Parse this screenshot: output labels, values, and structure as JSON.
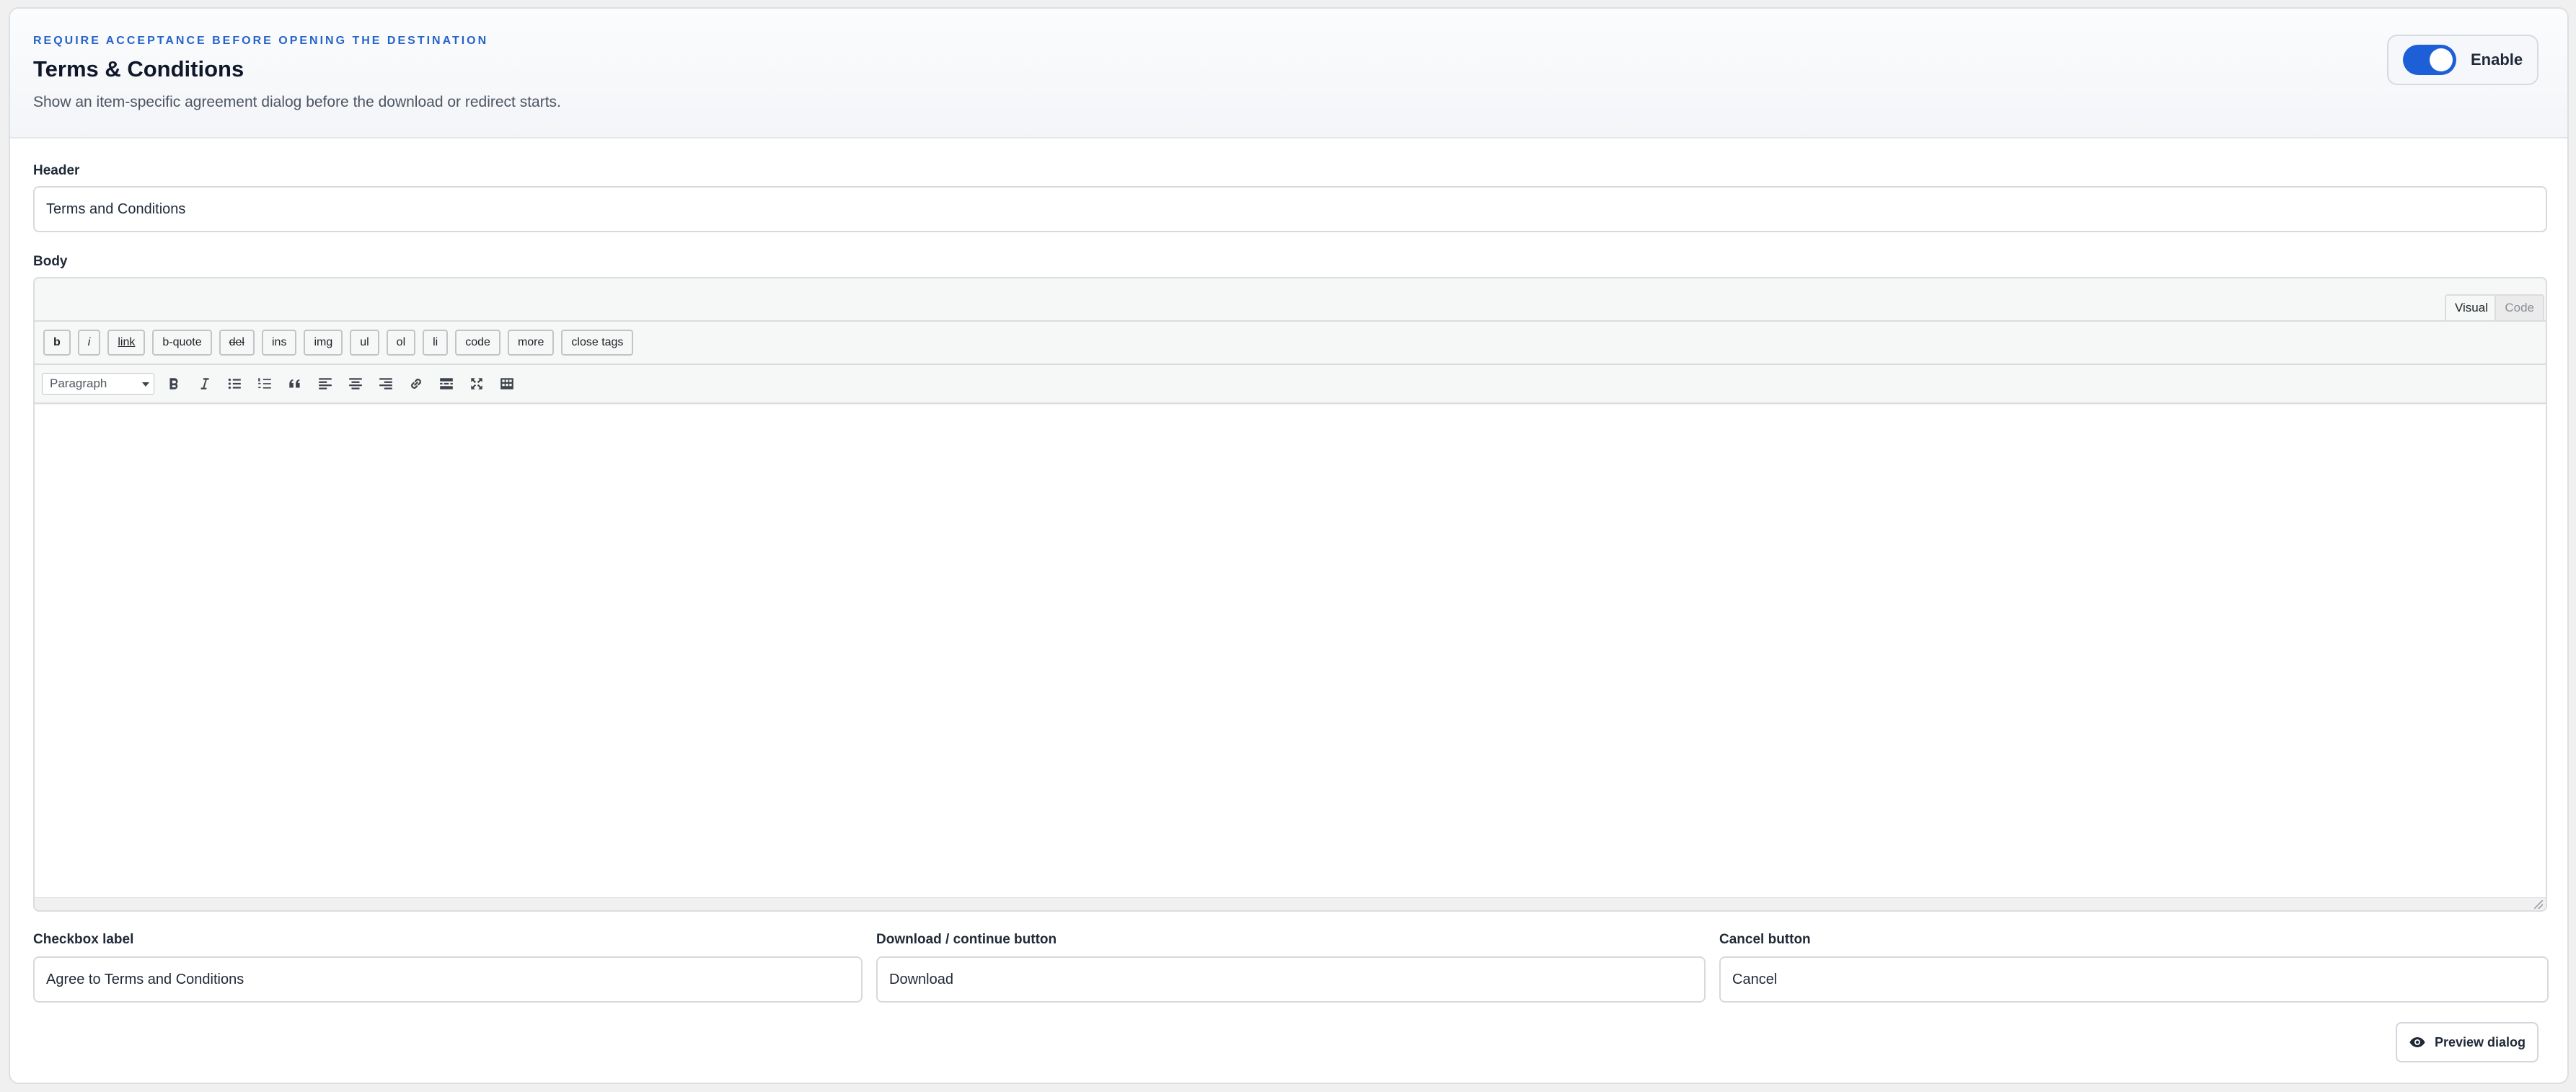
{
  "header": {
    "eyebrow": "REQUIRE ACCEPTANCE BEFORE OPENING THE DESTINATION",
    "title": "Terms & Conditions",
    "subtitle": "Show an item-specific agreement dialog before the download or redirect starts.",
    "enable_label": "Enable",
    "enabled": true,
    "accent_color": "#1d5fd6"
  },
  "fields": {
    "header_label": "Header",
    "header_value": "Terms and Conditions",
    "body_label": "Body",
    "checkbox_label_label": "Checkbox label",
    "checkbox_label_value": "Agree to Terms and Conditions",
    "continue_label": "Download / continue button",
    "continue_value": "Download",
    "cancel_label": "Cancel button",
    "cancel_value": "Cancel"
  },
  "editor": {
    "tabs": {
      "visual": "Visual",
      "code": "Code"
    },
    "quicktags": [
      "b",
      "i",
      "link",
      "b-quote",
      "del",
      "ins",
      "img",
      "ul",
      "ol",
      "li",
      "code",
      "more",
      "close tags"
    ],
    "format_select": "Paragraph",
    "toolbar_icons": [
      "bold-icon",
      "italic-icon",
      "bullet-list-icon",
      "numbered-list-icon",
      "blockquote-icon",
      "align-left-icon",
      "align-center-icon",
      "align-right-icon",
      "link-icon",
      "read-more-icon",
      "fullscreen-icon",
      "toolbar-toggle-icon"
    ],
    "content": ""
  },
  "actions": {
    "preview_label": "Preview dialog"
  }
}
